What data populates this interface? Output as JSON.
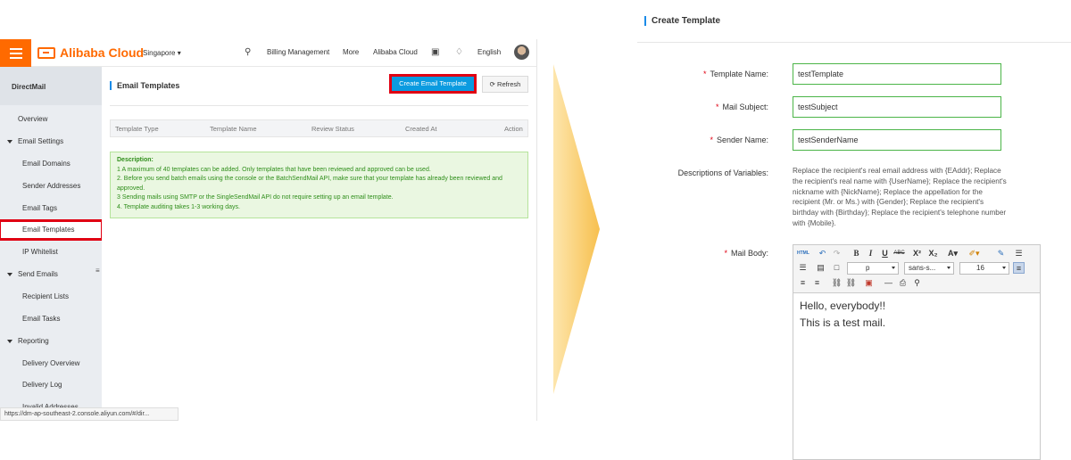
{
  "left_screen": {
    "header": {
      "brand": "Alibaba Cloud",
      "region": "Singapore ▾",
      "nav": [
        "Billing Management",
        "More",
        "Alibaba Cloud",
        "English"
      ]
    },
    "sidebar": {
      "product": "DirectMail",
      "items": [
        {
          "label": "Overview"
        },
        {
          "label": "Email Settings"
        },
        {
          "label": "Email Domains"
        },
        {
          "label": "Sender Addresses"
        },
        {
          "label": "Email Tags"
        },
        {
          "label": "Email Templates"
        },
        {
          "label": "IP Whitelist"
        },
        {
          "label": "Send Emails"
        },
        {
          "label": "Recipient Lists"
        },
        {
          "label": "Email Tasks"
        },
        {
          "label": "Reporting"
        },
        {
          "label": "Delivery Overview"
        },
        {
          "label": "Delivery Log"
        },
        {
          "label": "Invalid Addresses"
        }
      ]
    },
    "main": {
      "title": "Email Templates",
      "create_button": "Create Email Template",
      "refresh_button": "Refresh",
      "columns": [
        "Template Type",
        "Template Name",
        "Review Status",
        "Created At",
        "Action"
      ],
      "description": {
        "heading": "Description:",
        "lines": [
          "1 A maximum of 40 templates can be added. Only templates that have been reviewed and approved can be used.",
          "2. Before you send batch emails using the console or the BatchSendMail API, make sure that your template has already been reviewed and approved.",
          "3 Sending mails using SMTP or the SingleSendMail API do not require setting up an email template.",
          "4. Template auditing takes 1-3 working days."
        ]
      }
    },
    "status_url": "https://dm-ap-southeast-2.console.aliyun.com/#/dir..."
  },
  "right_screen": {
    "title": "Create Template",
    "form": {
      "template_name_label": "Template Name:",
      "template_name_value": "testTemplate",
      "mail_subject_label": "Mail Subject:",
      "mail_subject_value": "testSubject",
      "sender_name_label": "Sender Name:",
      "sender_name_value": "testSenderName",
      "variables_label": "Descriptions of Variables:",
      "variables_text": "Replace the recipient's real email address with {EAddr}; Replace the recipient's real name with {UserName}; Replace the recipient's nickname with {NickName}; Replace the appellation for the recipient (Mr. or Ms.) with {Gender}; Replace the recipient's birthday with {Birthday}; Replace the recipient's telephone number with {Mobile}.",
      "mail_body_label": "Mail Body:"
    },
    "editor": {
      "format_select": "p",
      "font_select": "sans-s...",
      "size_select": "16",
      "html_label": "HTML",
      "body_lines": [
        "Hello, everybody!!",
        "This is a test mail."
      ]
    }
  },
  "colors": {
    "brand_orange": "#ff6a00",
    "primary_blue": "#0b9be0",
    "highlight_red": "#e00012",
    "success_green": "#4bb548"
  }
}
